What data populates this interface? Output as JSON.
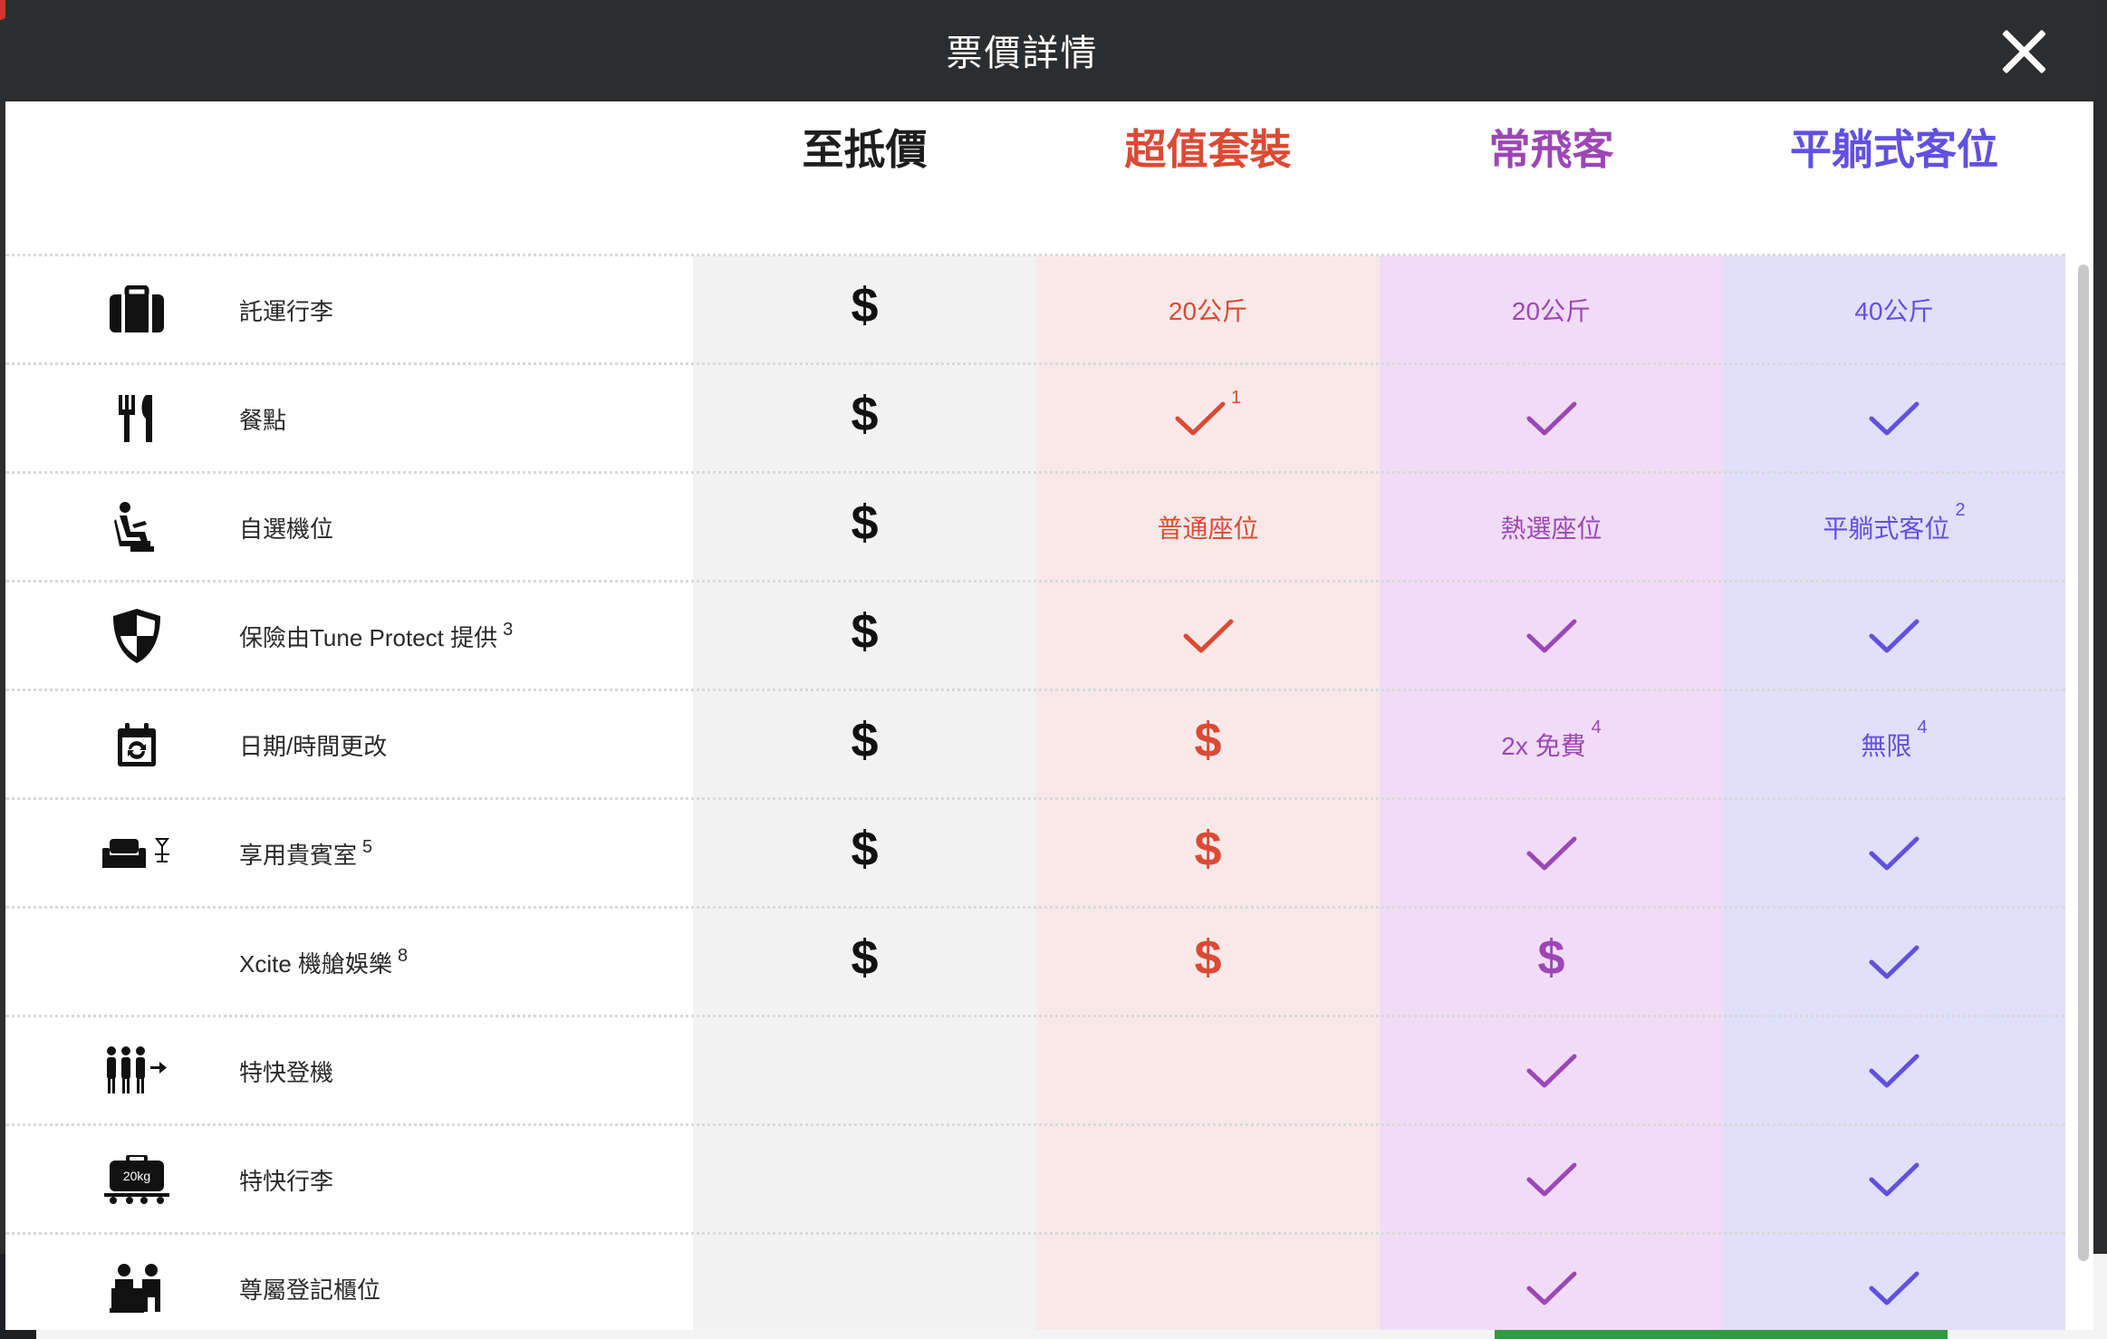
{
  "modal": {
    "title": "票價詳情",
    "close_label": "close"
  },
  "columns": [
    {
      "name": "至抵價",
      "color": "#1e1e1e"
    },
    {
      "name": "超值套裝",
      "color": "#db4a34"
    },
    {
      "name": "常飛客",
      "color": "#9c47b6"
    },
    {
      "name": "平躺式客位",
      "color": "#6051e0"
    }
  ],
  "rows": [
    {
      "label": "託運行李",
      "sup": "",
      "icon": "suitcase-icon",
      "cells": [
        {
          "t": "dollar"
        },
        {
          "t": "text",
          "v": "20公斤"
        },
        {
          "t": "text",
          "v": "20公斤"
        },
        {
          "t": "text",
          "v": "40公斤"
        }
      ]
    },
    {
      "label": "餐點",
      "sup": "",
      "icon": "fork-knife-icon",
      "cells": [
        {
          "t": "dollar"
        },
        {
          "t": "check",
          "sup": "1"
        },
        {
          "t": "check"
        },
        {
          "t": "check"
        }
      ]
    },
    {
      "label": "自選機位",
      "sup": "",
      "icon": "seat-icon",
      "cells": [
        {
          "t": "dollar"
        },
        {
          "t": "text",
          "v": "普通座位"
        },
        {
          "t": "text",
          "v": "熱選座位"
        },
        {
          "t": "text",
          "v": "平躺式客位",
          "sup": "2"
        }
      ]
    },
    {
      "label": "保險由Tune Protect 提供",
      "sup": "3",
      "icon": "shield-icon",
      "cells": [
        {
          "t": "dollar"
        },
        {
          "t": "check"
        },
        {
          "t": "check"
        },
        {
          "t": "check"
        }
      ]
    },
    {
      "label": "日期/時間更改",
      "sup": "",
      "icon": "calendar-change-icon",
      "cells": [
        {
          "t": "dollar"
        },
        {
          "t": "dollar"
        },
        {
          "t": "text",
          "v": "2x 免費",
          "sup": "4"
        },
        {
          "t": "text",
          "v": "無限",
          "sup": "4"
        }
      ]
    },
    {
      "label": "享用貴賓室",
      "sup": "5",
      "icon": "lounge-icon",
      "cells": [
        {
          "t": "dollar"
        },
        {
          "t": "dollar"
        },
        {
          "t": "check"
        },
        {
          "t": "check"
        }
      ]
    },
    {
      "label": "Xcite 機艙娛樂",
      "sup": "8",
      "icon": "",
      "cells": [
        {
          "t": "dollar"
        },
        {
          "t": "dollar"
        },
        {
          "t": "dollar"
        },
        {
          "t": "check"
        }
      ]
    },
    {
      "label": "特快登機",
      "sup": "",
      "icon": "priority-boarding-icon",
      "cells": [
        {
          "t": "none"
        },
        {
          "t": "none"
        },
        {
          "t": "check"
        },
        {
          "t": "check"
        }
      ]
    },
    {
      "label": "特快行李",
      "sup": "",
      "icon": "priority-baggage-icon",
      "baggage_tag": "20kg",
      "cells": [
        {
          "t": "none"
        },
        {
          "t": "none"
        },
        {
          "t": "check"
        },
        {
          "t": "check"
        }
      ]
    },
    {
      "label": "尊屬登記櫃位",
      "sup": "",
      "icon": "check-in-counter-icon",
      "cells": [
        {
          "t": "none"
        },
        {
          "t": "none"
        },
        {
          "t": "check"
        },
        {
          "t": "check"
        }
      ]
    }
  ]
}
